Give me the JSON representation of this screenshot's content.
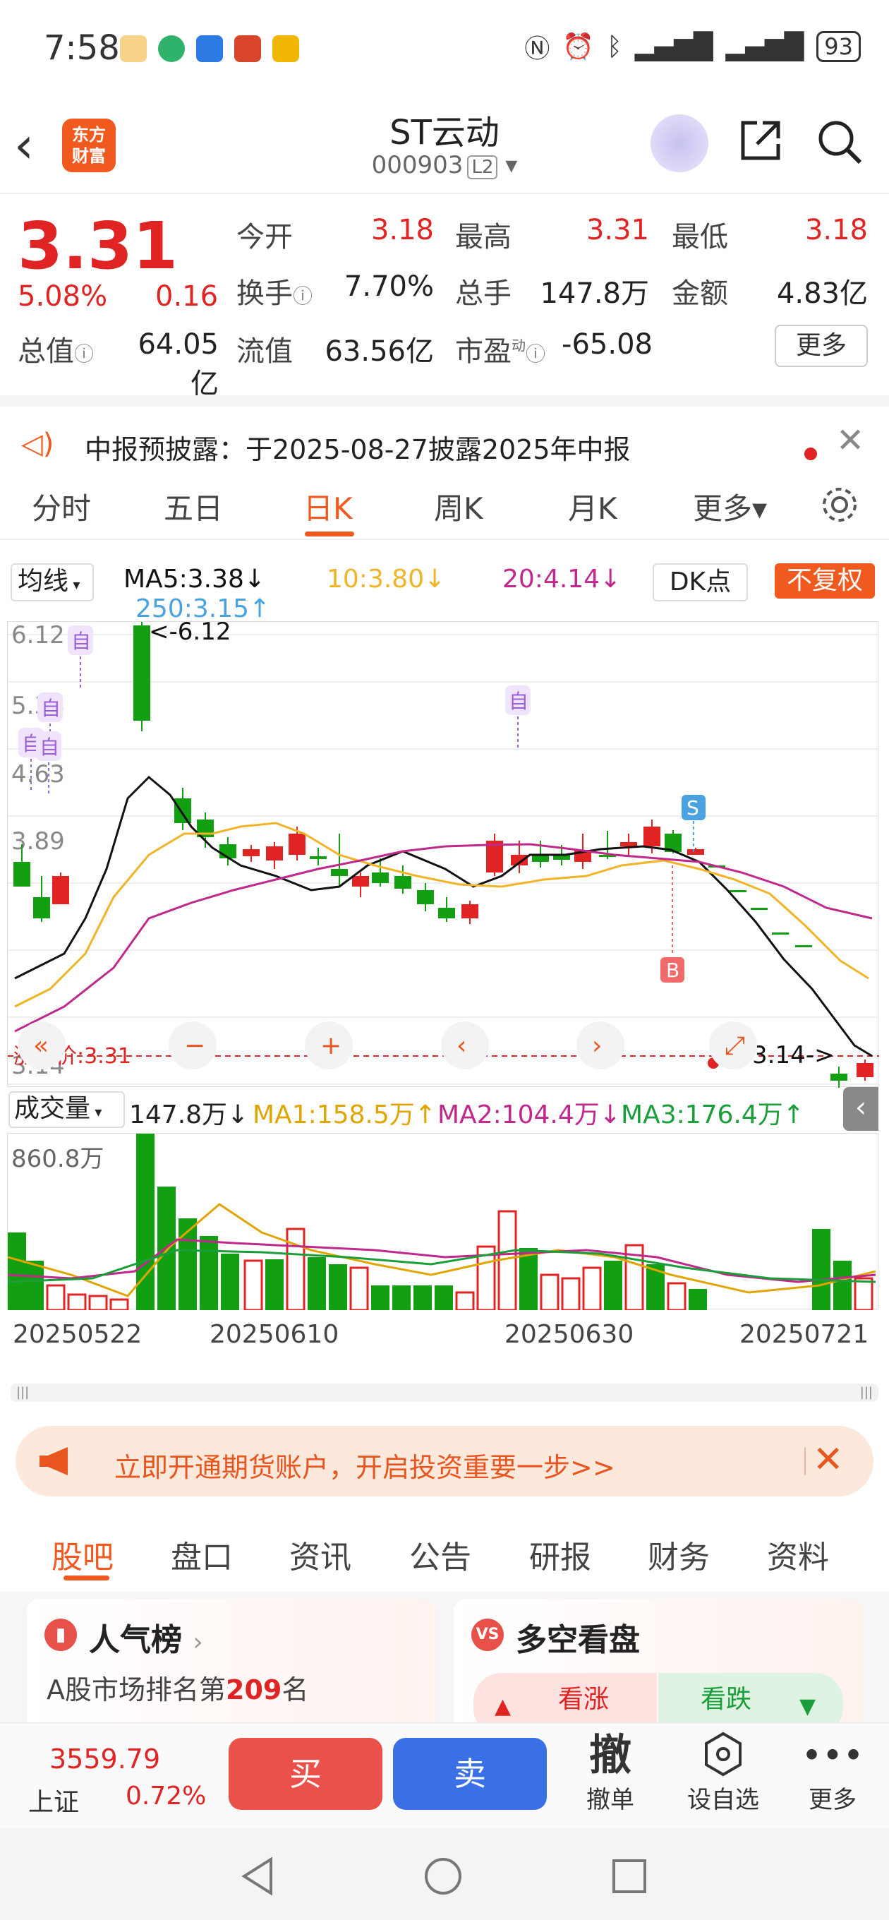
{
  "status": {
    "time": "7:58",
    "battery": "93"
  },
  "header": {
    "stock_name": "ST云动",
    "stock_code": "000903",
    "level": "L2",
    "logo": "东方财富"
  },
  "quote": {
    "price": "3.31",
    "pct": "5.08%",
    "change": "0.16",
    "fields": [
      {
        "label": "今开",
        "value": "3.18"
      },
      {
        "label": "最高",
        "value": "3.31"
      },
      {
        "label": "最低",
        "value": "3.18"
      },
      {
        "label": "换手",
        "value": "7.70%"
      },
      {
        "label": "总手",
        "value": "147.8万"
      },
      {
        "label": "金额",
        "value": "4.83亿"
      },
      {
        "label": "总值",
        "value": "64.05亿"
      },
      {
        "label": "流值",
        "value": "63.56亿"
      },
      {
        "label": "市盈",
        "value": "-65.08"
      }
    ],
    "pe_sup": "动",
    "more": "更多"
  },
  "notice": {
    "text": "中报预披露：于2025-08-27披露2025年中报"
  },
  "tabs": [
    "分时",
    "五日",
    "日K",
    "周K",
    "月K",
    "更多▾"
  ],
  "chart_bar": {
    "indicator": "均线",
    "ma5": "MA5:3.38↓",
    "ma10": "10:3.80↓",
    "ma20": "20:4.14↓",
    "ma250": "250:3.15↑",
    "dk": "DK点",
    "fq": "不复权"
  },
  "kline": {
    "y_labels": [
      "6.12",
      "5.38",
      "4.63",
      "3.89",
      "3.14"
    ],
    "high_marker": "<-6.12",
    "low_marker": "3.14->",
    "limit_price": "涨停价:3.31",
    "self_tag": "自",
    "s_tag": "S",
    "b_tag": "B",
    "colors": {
      "up": "#e02424",
      "down": "#12a012",
      "ma5": "#111111",
      "ma10": "#f0b429",
      "ma20": "#c0288c",
      "ma250": "#4aa3df"
    }
  },
  "volume_bar": {
    "label": "成交量",
    "value": "147.8万↓",
    "ma1": "MA1:158.5万↑",
    "ma2": "MA2:104.4万↓",
    "ma3": "MA3:176.4万↑",
    "y_label": "860.8万"
  },
  "dates": [
    "20250522",
    "20250610",
    "20250630",
    "20250721"
  ],
  "ad": {
    "text": "立即开通期货账户，开启投资重要一步>>"
  },
  "subtabs": [
    "股吧",
    "盘口",
    "资讯",
    "公告",
    "研报",
    "财务",
    "资料"
  ],
  "cards": {
    "left_title": "人气榜",
    "left_text_pre": "A股市场排名第",
    "left_rank": "209",
    "left_text_post": "名",
    "right_title": "多空看盘",
    "right_up": "看涨",
    "right_down": "看跌"
  },
  "bottom": {
    "index_value": "3559.79",
    "index_name": "上证",
    "index_pct": "0.72%",
    "buy": "买",
    "sell": "卖",
    "cancel": "撤",
    "cancel_label": "撤单",
    "watch_label": "设自选",
    "more_label": "更多"
  }
}
